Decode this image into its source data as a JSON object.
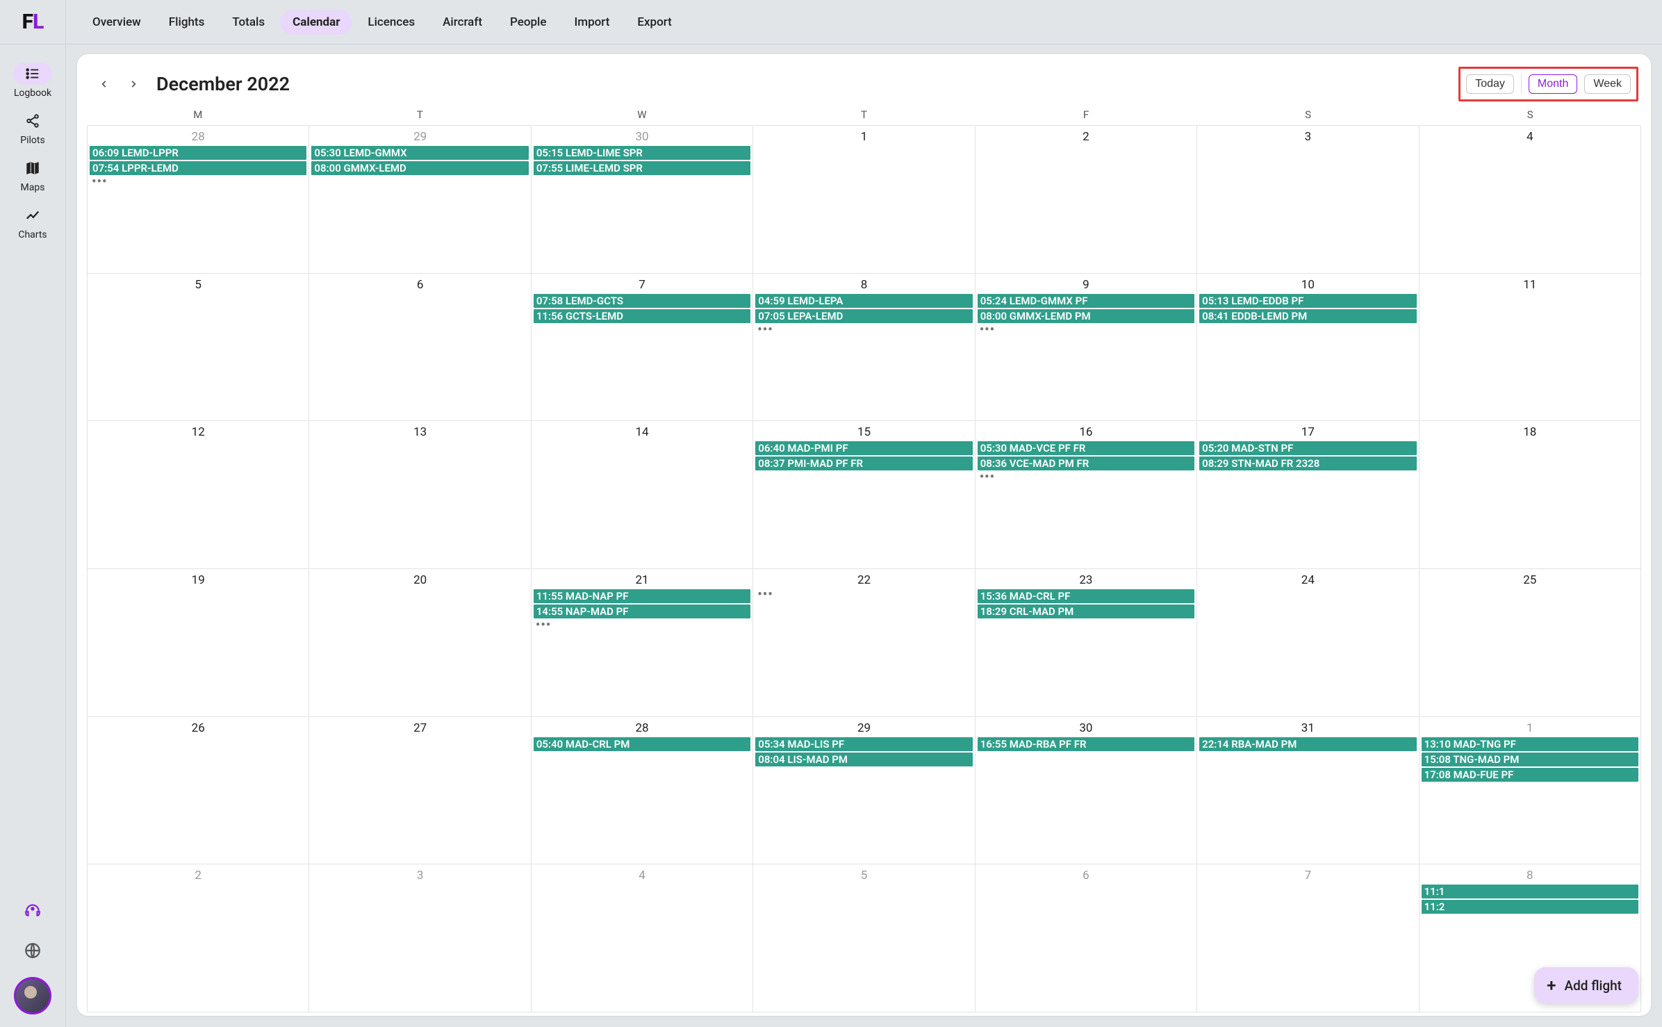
{
  "logo": {
    "f": "F",
    "l": "L"
  },
  "nav": {
    "items": [
      "Overview",
      "Flights",
      "Totals",
      "Calendar",
      "Licences",
      "Aircraft",
      "People",
      "Import",
      "Export"
    ],
    "activeIndex": 3
  },
  "sidebar": {
    "items": [
      {
        "label": "Logbook",
        "icon": "list-icon"
      },
      {
        "label": "Pilots",
        "icon": "share-icon"
      },
      {
        "label": "Maps",
        "icon": "map-icon"
      },
      {
        "label": "Charts",
        "icon": "chart-icon"
      }
    ],
    "activeIndex": 0
  },
  "calendar": {
    "title": "December 2022",
    "dow": [
      "M",
      "T",
      "W",
      "T",
      "F",
      "S",
      "S"
    ],
    "view": {
      "today": "Today",
      "month": "Month",
      "week": "Week"
    },
    "cells": [
      {
        "n": "28",
        "muted": true,
        "events": [
          "06:09 LEMD-LPPR",
          "07:54 LPPR-LEMD"
        ],
        "more": true
      },
      {
        "n": "29",
        "muted": true,
        "events": [
          "05:30 LEMD-GMMX",
          "08:00 GMMX-LEMD"
        ]
      },
      {
        "n": "30",
        "muted": true,
        "events": [
          "05:15 LEMD-LIME SPR",
          "07:55 LIME-LEMD SPR"
        ]
      },
      {
        "n": "1",
        "events": []
      },
      {
        "n": "2",
        "events": []
      },
      {
        "n": "3",
        "events": []
      },
      {
        "n": "4",
        "events": []
      },
      {
        "n": "5",
        "events": []
      },
      {
        "n": "6",
        "events": []
      },
      {
        "n": "7",
        "events": [
          "07:58 LEMD-GCTS",
          "11:56 GCTS-LEMD"
        ]
      },
      {
        "n": "8",
        "events": [
          "04:59 LEMD-LEPA",
          "07:05 LEPA-LEMD"
        ],
        "more": true
      },
      {
        "n": "9",
        "events": [
          "05:24 LEMD-GMMX PF",
          "08:00 GMMX-LEMD PM"
        ],
        "more": true
      },
      {
        "n": "10",
        "events": [
          "05:13 LEMD-EDDB PF",
          "08:41 EDDB-LEMD PM"
        ]
      },
      {
        "n": "11",
        "events": []
      },
      {
        "n": "12",
        "events": []
      },
      {
        "n": "13",
        "events": []
      },
      {
        "n": "14",
        "events": []
      },
      {
        "n": "15",
        "events": [
          "06:40 MAD-PMI PF",
          "08:37 PMI-MAD PF FR"
        ]
      },
      {
        "n": "16",
        "events": [
          "05:30 MAD-VCE PF FR",
          "08:36 VCE-MAD PM FR"
        ],
        "more": true
      },
      {
        "n": "17",
        "events": [
          "05:20 MAD-STN PF",
          "08:29 STN-MAD FR 2328"
        ]
      },
      {
        "n": "18",
        "events": []
      },
      {
        "n": "19",
        "events": []
      },
      {
        "n": "20",
        "events": []
      },
      {
        "n": "21",
        "events": [
          "11:55 MAD-NAP PF",
          "14:55 NAP-MAD PF"
        ],
        "more": true
      },
      {
        "n": "22",
        "events": [],
        "more": true
      },
      {
        "n": "23",
        "events": [
          "15:36 MAD-CRL PF",
          "18:29 CRL-MAD PM"
        ]
      },
      {
        "n": "24",
        "events": []
      },
      {
        "n": "25",
        "events": []
      },
      {
        "n": "26",
        "events": []
      },
      {
        "n": "27",
        "events": []
      },
      {
        "n": "28",
        "events": [
          "05:40 MAD-CRL PM"
        ]
      },
      {
        "n": "29",
        "events": [
          "05:34 MAD-LIS PF",
          "08:04 LIS-MAD PM"
        ]
      },
      {
        "n": "30",
        "events": [
          "16:55 MAD-RBA PF FR"
        ]
      },
      {
        "n": "31",
        "events": [
          "22:14 RBA-MAD PM"
        ]
      },
      {
        "n": "1",
        "muted": true,
        "events": [
          "13:10 MAD-TNG PF",
          "15:08 TNG-MAD PM",
          "17:08 MAD-FUE PF"
        ]
      },
      {
        "n": "2",
        "muted": true,
        "events": []
      },
      {
        "n": "3",
        "muted": true,
        "events": []
      },
      {
        "n": "4",
        "muted": true,
        "events": []
      },
      {
        "n": "5",
        "muted": true,
        "events": []
      },
      {
        "n": "6",
        "muted": true,
        "events": []
      },
      {
        "n": "7",
        "muted": true,
        "events": []
      },
      {
        "n": "8",
        "muted": true,
        "events": [
          "11:1",
          "11:2"
        ]
      }
    ]
  },
  "fab": {
    "label": "Add flight"
  }
}
